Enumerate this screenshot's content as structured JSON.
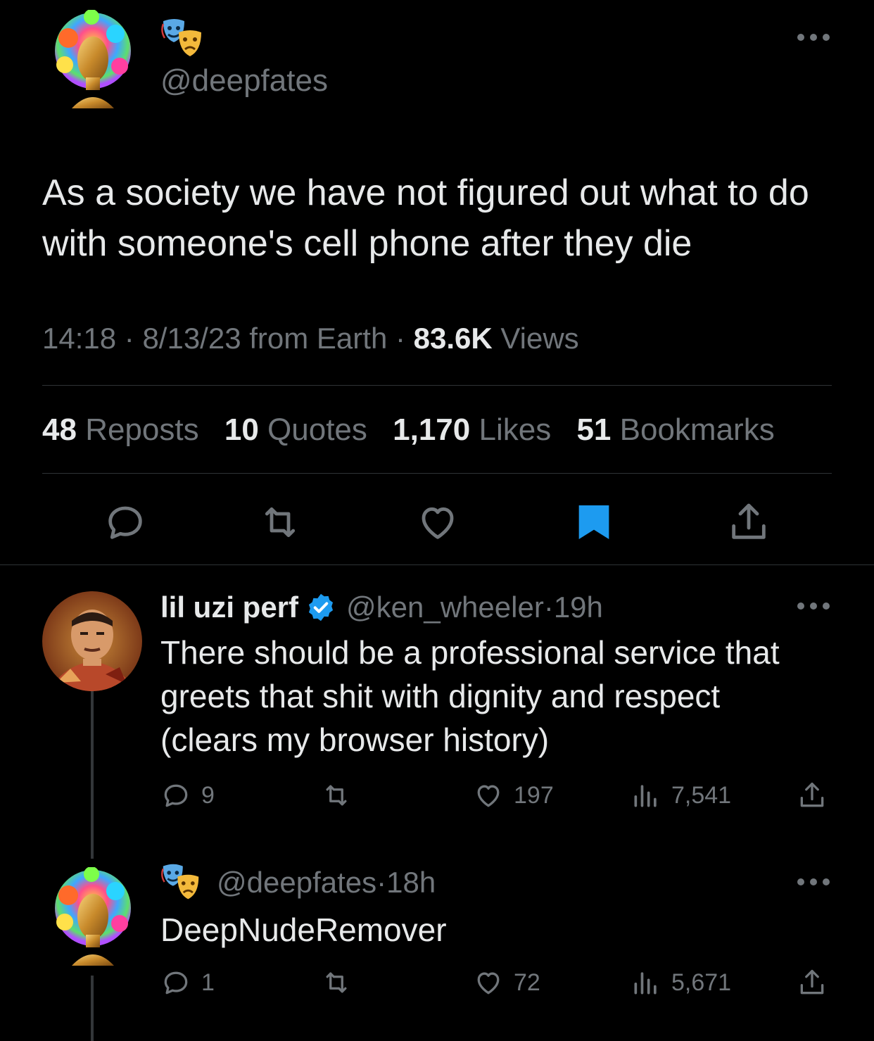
{
  "main_tweet": {
    "handle": "@deepfates",
    "text": "As a society we have not figured out what to do with someone's cell phone after they die",
    "time": "14:18",
    "date": "8/13/23",
    "source": "from Earth",
    "views_count": "83.6K",
    "views_label": "Views",
    "stats": {
      "reposts_count": "48",
      "reposts_label": "Reposts",
      "quotes_count": "10",
      "quotes_label": "Quotes",
      "likes_count": "1,170",
      "likes_label": "Likes",
      "bookmarks_count": "51",
      "bookmarks_label": "Bookmarks"
    },
    "bookmarked": true,
    "accent_color": "#1d9bf0"
  },
  "replies": [
    {
      "display_name": "lil uzi perf",
      "verified": true,
      "handle": "@ken_wheeler",
      "time": "19h",
      "text_lines": [
        "There should be a professional service that",
        "greets that shit with dignity and respect",
        "(clears my browser history)"
      ],
      "replies_count": "9",
      "likes_count": "197",
      "views_count": "7,541"
    },
    {
      "handle": "@deepfates",
      "time": "18h",
      "text": "DeepNudeRemover",
      "replies_count": "1",
      "likes_count": "72",
      "views_count": "5,671"
    }
  ],
  "icons": {
    "reply": "reply-icon",
    "repost": "repost-icon",
    "like": "heart-icon",
    "bookmark": "bookmark-icon",
    "share": "share-icon",
    "views": "views-icon",
    "more": "more-icon",
    "verified": "verified-badge-icon",
    "masks": "theater-masks-icon"
  }
}
